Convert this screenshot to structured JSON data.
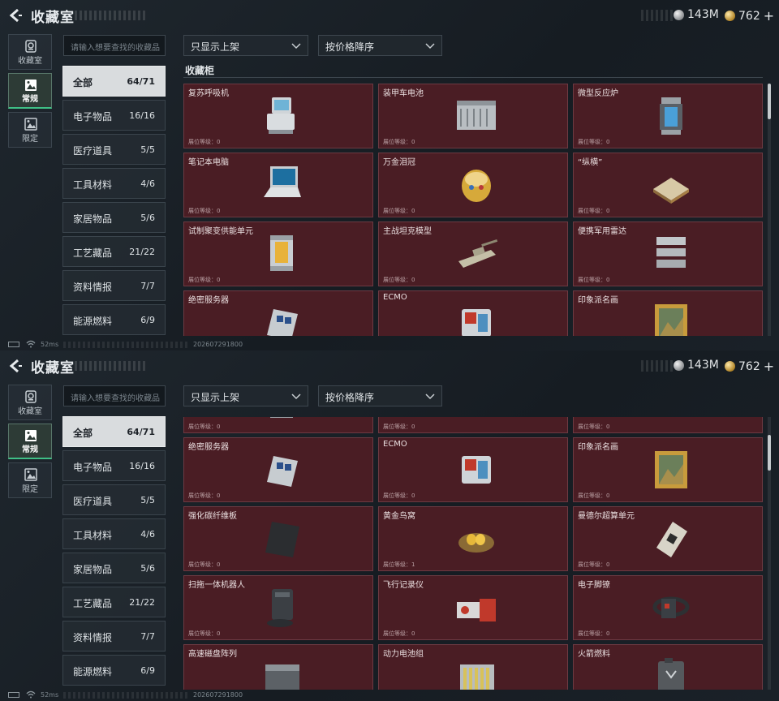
{
  "header": {
    "title": "收藏室",
    "currency": [
      {
        "icon": "silver-coin-icon",
        "value": "143M"
      },
      {
        "icon": "gold-coin-icon",
        "value": "762",
        "suffix": "+"
      }
    ]
  },
  "sidebar": {
    "items": [
      {
        "label": "收藏室",
        "icon": "collection-room-icon",
        "active": false
      },
      {
        "label": "常规",
        "icon": "regular-picture-icon",
        "active": true
      },
      {
        "label": "限定",
        "icon": "limited-picture-icon",
        "active": false
      }
    ]
  },
  "search": {
    "placeholder": "请输入想要查找的收藏品"
  },
  "filters": {
    "filter_label": "只显示上架",
    "sort_label": "按价格降序"
  },
  "categories": [
    {
      "label": "全部",
      "count": "64/71",
      "active": true
    },
    {
      "label": "电子物品",
      "count": "16/16"
    },
    {
      "label": "医疗道具",
      "count": "5/5"
    },
    {
      "label": "工具材料",
      "count": "4/6"
    },
    {
      "label": "家居物品",
      "count": "5/6"
    },
    {
      "label": "工艺藏品",
      "count": "21/22"
    },
    {
      "label": "资料情报",
      "count": "7/7"
    },
    {
      "label": "能源燃料",
      "count": "6/9"
    }
  ],
  "cabinet": {
    "title": "收藏柜",
    "level_label": "展位等级：",
    "items": [
      {
        "name": "复苏呼吸机",
        "level": "0",
        "icon": "ventilator-icon"
      },
      {
        "name": "装甲车电池",
        "level": "0",
        "icon": "armored-battery-icon"
      },
      {
        "name": "微型反应炉",
        "level": "0",
        "icon": "micro-reactor-icon"
      },
      {
        "name": "笔记本电脑",
        "level": "0",
        "icon": "laptop-icon"
      },
      {
        "name": "万金泪冠",
        "level": "0",
        "icon": "jeweled-egg-icon"
      },
      {
        "name": "“纵横”",
        "level": "0",
        "icon": "chess-board-icon"
      },
      {
        "name": "试制聚变供能单元",
        "level": "0",
        "icon": "fusion-unit-icon"
      },
      {
        "name": "主战坦克模型",
        "level": "0",
        "icon": "tank-model-icon"
      },
      {
        "name": "便携军用雷达",
        "level": "0",
        "icon": "portable-radar-icon"
      },
      {
        "name": "绝密服务器",
        "level": "0",
        "icon": "server-icon"
      },
      {
        "name": "ECMO",
        "level": "0",
        "icon": "ecmo-icon"
      },
      {
        "name": "印象派名画",
        "level": "0",
        "icon": "painting-icon"
      },
      {
        "name": "强化碳纤维板",
        "level": "0",
        "icon": "carbon-plate-icon"
      },
      {
        "name": "黄金鸟窝",
        "level": "1",
        "icon": "golden-nest-icon"
      },
      {
        "name": "曼德尔超算单元",
        "level": "0",
        "icon": "supercomputer-unit-icon"
      },
      {
        "name": "扫拖一体机器人",
        "level": "0",
        "icon": "robot-vacuum-icon"
      },
      {
        "name": "飞行记录仪",
        "level": "0",
        "icon": "flight-recorder-icon"
      },
      {
        "name": "电子脚镣",
        "level": "0",
        "icon": "electronic-anklet-icon"
      },
      {
        "name": "高速磁盘阵列",
        "level": "0",
        "icon": "disk-array-icon"
      },
      {
        "name": "动力电池组",
        "level": "0",
        "icon": "battery-pack-icon"
      },
      {
        "name": "火箭燃料",
        "level": "0",
        "icon": "rocket-fuel-icon"
      }
    ]
  },
  "statusbar": {
    "ping": "52ms",
    "code": "202607291800"
  }
}
